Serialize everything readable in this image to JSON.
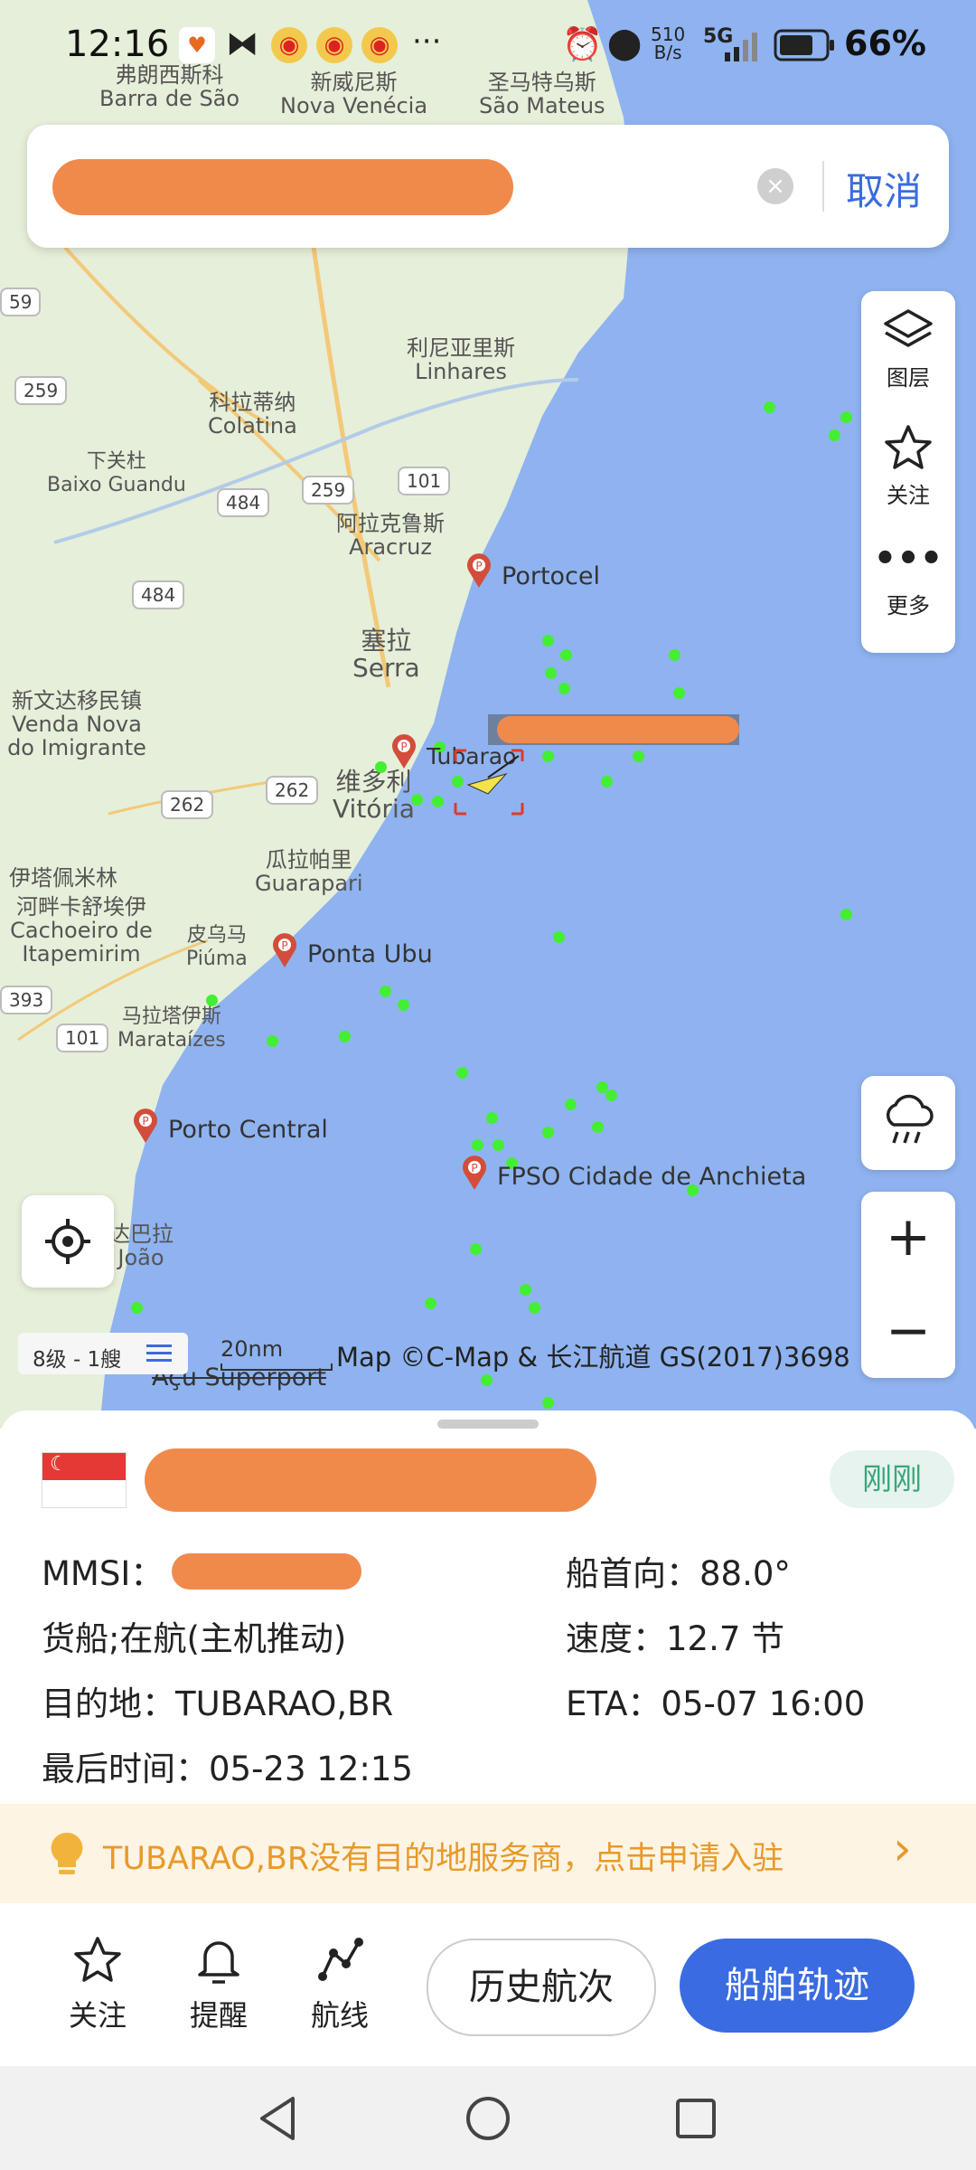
{
  "status_bar": {
    "time": "12:16",
    "net_speed_value": "510",
    "net_speed_unit": "B/s",
    "network": "5G",
    "battery": "66%"
  },
  "search": {
    "cancel_label": "取消"
  },
  "tools": {
    "layers_label": "图层",
    "follow_label": "关注",
    "more_label": "更多"
  },
  "map": {
    "places": [
      {
        "zh": "弗朗西斯科",
        "lat": "Barra de São"
      },
      {
        "zh": "新威尼斯",
        "lat": "Nova Venécia"
      },
      {
        "zh": "圣马特乌斯",
        "lat": "São Mateus"
      },
      {
        "zh": "利尼亚里斯",
        "lat": "Linhares"
      },
      {
        "zh": "科拉蒂纳",
        "lat": "Colatina"
      },
      {
        "zh": "下关杜",
        "lat": "Baixo Guandu"
      },
      {
        "zh": "阿拉克鲁斯",
        "lat": "Aracruz"
      },
      {
        "zh": "塞拉",
        "lat": "Serra"
      },
      {
        "zh": "新文达移民镇",
        "lat": "Venda Nova do Imigrante"
      },
      {
        "zh": "维多利",
        "lat": "Vitória"
      },
      {
        "zh": "瓜拉帕里",
        "lat": "Guarapari"
      },
      {
        "zh": "伊塔佩米林",
        "lat": ""
      },
      {
        "zh": "河畔卡舒埃伊",
        "lat": "Cachoeiro de Itapemirim"
      },
      {
        "zh": "皮乌马",
        "lat": "Piúma"
      },
      {
        "zh": "马拉塔伊斯",
        "lat": "Marataízes"
      },
      {
        "zh": "达巴拉",
        "lat": "João"
      }
    ],
    "roads": [
      "259",
      "484",
      "259",
      "101",
      "484",
      "262",
      "262",
      "101",
      "393",
      "59"
    ],
    "ports": [
      "Portocel",
      "Tubarao",
      "Ponta Ubu",
      "Porto Central",
      "FPSO Cidade de Anchieta",
      "Açu Superport"
    ],
    "zoom_label": "8级 - 1艘",
    "scale_label": "20nm",
    "attribution": "Map ©C-Map & 长江航道 GS(2017)3698"
  },
  "vessel": {
    "updated_badge": "刚刚",
    "mmsi_label": "MMSI：",
    "heading": "船首向：88.0°",
    "type_status": "货船;在航(主机推动)",
    "speed": "速度：12.7 节",
    "destination": "目的地：TUBARAO,BR",
    "eta": "ETA：05-07 16:00",
    "last_time": "最后时间：05-23 12:15"
  },
  "banner": {
    "text": "TUBARAO,BR没有目的地服务商，点击申请入驻"
  },
  "actions": {
    "follow": "关注",
    "remind": "提醒",
    "route": "航线",
    "history": "历史航次",
    "track": "船舶轨迹"
  },
  "colors": {
    "sea": "#8fb3f0",
    "land": "#e6efd9",
    "accent": "#3a6be0",
    "ship_dot": "#44ee33",
    "redaction": "#f08a4b",
    "banner_text": "#e79a2a"
  }
}
